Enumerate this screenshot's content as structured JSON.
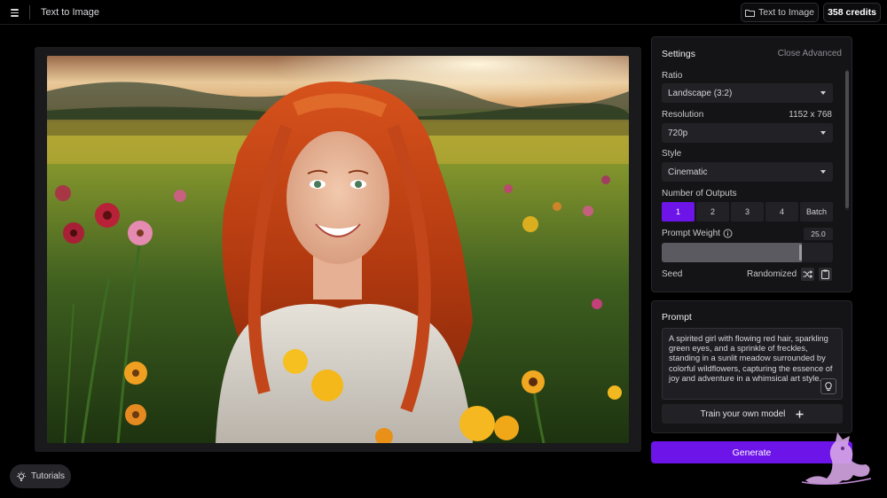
{
  "header": {
    "page_title": "Text to Image",
    "text_to_image_button": "Text to Image",
    "credits_button": "358 credits",
    "icons": [
      "hamburger-menu-icon",
      "folder-icon"
    ]
  },
  "image_preview": {
    "subject": "red-haired smiling girl in a sunlit wildflower meadow"
  },
  "settings": {
    "title": "Settings",
    "close_advanced": "Close Advanced",
    "ratio": {
      "label": "Ratio",
      "value": "Landscape (3:2)"
    },
    "resolution": {
      "label": "Resolution",
      "dimensions": "1152 x 768",
      "value": "720p"
    },
    "style": {
      "label": "Style",
      "value": "Cinematic"
    },
    "outputs": {
      "label": "Number of Outputs",
      "options": [
        "1",
        "2",
        "3",
        "4",
        "Batch"
      ],
      "selected": "1"
    },
    "prompt_weight": {
      "label": "Prompt Weight",
      "value": "25.0",
      "fill_fraction": 0.82
    },
    "seed": {
      "label": "Seed",
      "value": "Randomized"
    }
  },
  "prompt": {
    "title": "Prompt",
    "text": "A spirited girl with flowing red hair, sparkling green eyes, and a sprinkle of freckles, standing in a sunlit meadow surrounded by colorful wildflowers, capturing the essence of joy and adventure in a whimsical art style.",
    "train_button": "Train your own model"
  },
  "generate_button": "Generate",
  "tutorials_button": "Tutorials",
  "colors": {
    "accent": "#6d14e8",
    "background": "#000000",
    "panel": "#141417",
    "control": "#222226"
  }
}
